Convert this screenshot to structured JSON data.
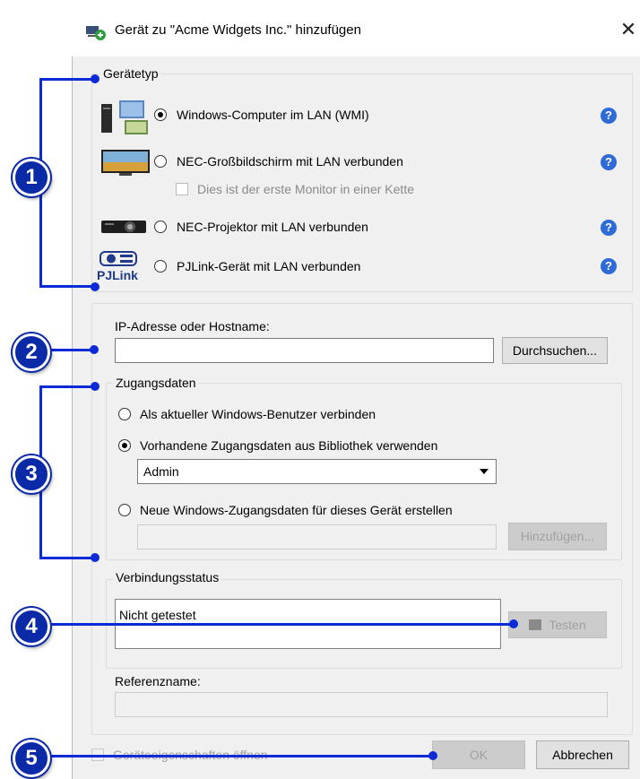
{
  "dialog": {
    "title": "Gerät zu \"Acme Widgets Inc.\" hinzufügen",
    "close_glyph": "✕"
  },
  "device_type": {
    "legend": "Gerätetyp",
    "options": [
      {
        "label": "Windows-Computer im LAN (WMI)",
        "selected": true,
        "icon": "windows-computer-icon"
      },
      {
        "label": "NEC-Großbildschirm mit LAN verbunden",
        "selected": false,
        "icon": "large-display-icon"
      },
      {
        "label": "NEC-Projektor mit LAN verbunden",
        "selected": false,
        "icon": "projector-icon"
      },
      {
        "label": "PJLink-Gerät mit LAN verbunden",
        "selected": false,
        "icon": "pjlink-icon"
      }
    ],
    "first_monitor_checkbox": "Dies ist der erste Monitor in einer Kette",
    "pjlink_text": "PJLink",
    "help_glyph": "?"
  },
  "address": {
    "label": "IP-Adresse oder Hostname:",
    "value": "",
    "browse_button": "Durchsuchen..."
  },
  "credentials": {
    "legend": "Zugangsdaten",
    "option_current_user": "Als aktueller Windows-Benutzer verbinden",
    "option_library": "Vorhandene Zugangsdaten aus Bibliothek verwenden",
    "library_selected": "Admin",
    "option_new": "Neue Windows-Zugangsdaten für dieses Gerät erstellen",
    "add_button": "Hinzufügen..."
  },
  "connection": {
    "legend": "Verbindungsstatus",
    "status_text": "Nicht getestet",
    "test_button": "Testen"
  },
  "reference": {
    "label": "Referenzname:",
    "value": ""
  },
  "footer": {
    "open_properties_checkbox": "Geräteeigenschaften öffnen",
    "ok_button": "OK",
    "cancel_button": "Abbrechen"
  },
  "callouts": [
    "1",
    "2",
    "3",
    "4",
    "5"
  ],
  "colors": {
    "callout": "#0a2aa8",
    "help": "#2e6bd6",
    "window_bg": "#f0f0f0"
  }
}
